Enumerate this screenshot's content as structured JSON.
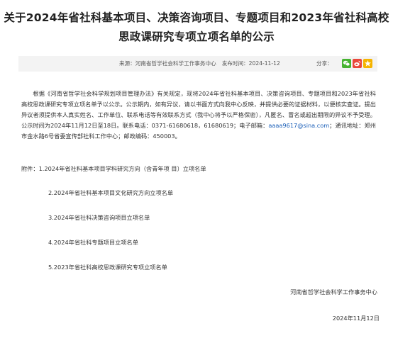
{
  "article": {
    "title_line1": "关于2024年省社科基本项目、决策咨询项目、专题项目和2023年省社科高校",
    "title_line2": "思政课研究专项立项名单的公示",
    "source_label": "来源：",
    "source": "河南省哲学社会科学工作事务中心",
    "published_label": "发布时间：",
    "published": "2024-11-12",
    "share_label": "分享：",
    "body_lead": "根据《河南省哲学社会科学规划项目管理办法》有关规定，现将2024年省社科基本项目、决策咨询项目、专题项目和2023年省社科高校思政课研究专项立项名单予以公示。公示期内，如有异议，请以书面方式向我中心反映，并提供必要的证据材料，以便核实查证。提出异议者须提供本人真实姓名、工作单位、联系电话等有效联系方式（我中心将予以严格保密），凡匿名、冒名或超出期限的异议不予受理。公示时间为2024年11月12日至18日。联系电话：0371-61680618，61680619；电子邮箱：",
    "email": "aaaa9617@sina.com",
    "body_tail": "；通讯地址：郑州市金水路6号省委宣传部社科工作中心；邮政编码：450003。",
    "attachments_label": "附件：",
    "attachments": [
      "1.2024年省社科基本项目学科研究方向（含青年项 目）立项名单",
      "2.2024年省社科基本项目文化研究方向立项名单",
      "3.2024年省社科决策咨询项目立项名单",
      "4.2024年省社科专题项目立项名单",
      "5.2023年省社科高校思政课研究专项立项名单"
    ],
    "signature": "河南省哲学社会科学工作事务中心",
    "date": "2024年11月12日"
  },
  "icons": {
    "share": [
      "wechat-icon",
      "weibo-icon",
      "qzone-icon"
    ]
  },
  "colors": {
    "email_link": "#1b5fb8",
    "wechat": "#46b330",
    "weibo": "#e9473b",
    "qzone": "#f5b400",
    "meta_bar": "#f3f3f3"
  }
}
